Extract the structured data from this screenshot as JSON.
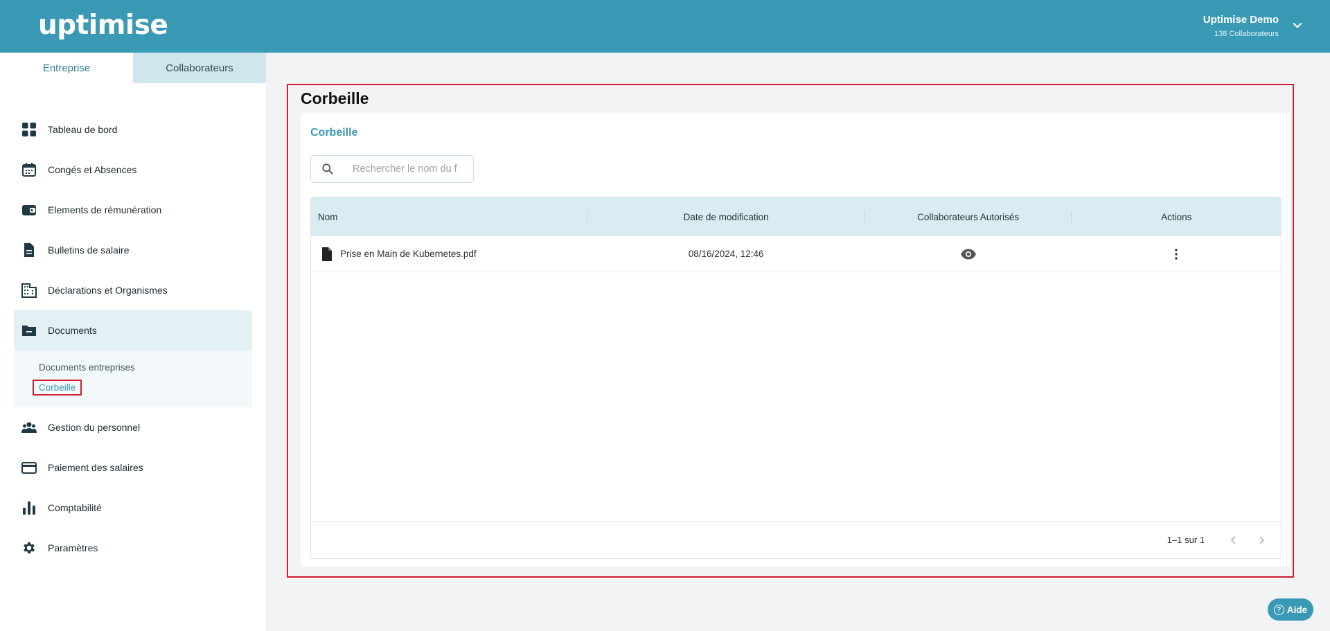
{
  "header": {
    "logo": "uptimise",
    "user_name": "Uptimise Demo",
    "user_sub": "138 Collaborateurs"
  },
  "sidebar": {
    "tabs": [
      "Entreprise",
      "Collaborateurs"
    ],
    "items": [
      {
        "label": "Tableau de bord",
        "icon": "dashboard-icon"
      },
      {
        "label": "Congés et Absences",
        "icon": "calendar-icon"
      },
      {
        "label": "Elements de rémunération",
        "icon": "wallet-icon"
      },
      {
        "label": "Bulletins de salaire",
        "icon": "file-icon"
      },
      {
        "label": "Déclarations et Organismes",
        "icon": "building-icon"
      },
      {
        "label": "Documents",
        "icon": "folder-icon"
      },
      {
        "label": "Gestion du personnel",
        "icon": "people-icon"
      },
      {
        "label": "Paiement des salaires",
        "icon": "credit-card-icon"
      },
      {
        "label": "Comptabilité",
        "icon": "bar-chart-icon"
      },
      {
        "label": "Paramètres",
        "icon": "gear-icon"
      }
    ],
    "documents_sub": [
      "Documents entreprises",
      "Corbeille"
    ]
  },
  "main": {
    "page_title": "Corbeille",
    "panel_title": "Corbeille",
    "search_placeholder": "Rechercher le nom du f",
    "columns": [
      "Nom",
      "Date de modification",
      "Collaborateurs Autorisés",
      "Actions"
    ],
    "rows": [
      {
        "name": "Prise en Main de Kubernetes.pdf",
        "date": "08/16/2024, 12:46"
      }
    ],
    "pagination": "1–1 sur 1"
  },
  "help": {
    "label": "Aide"
  }
}
